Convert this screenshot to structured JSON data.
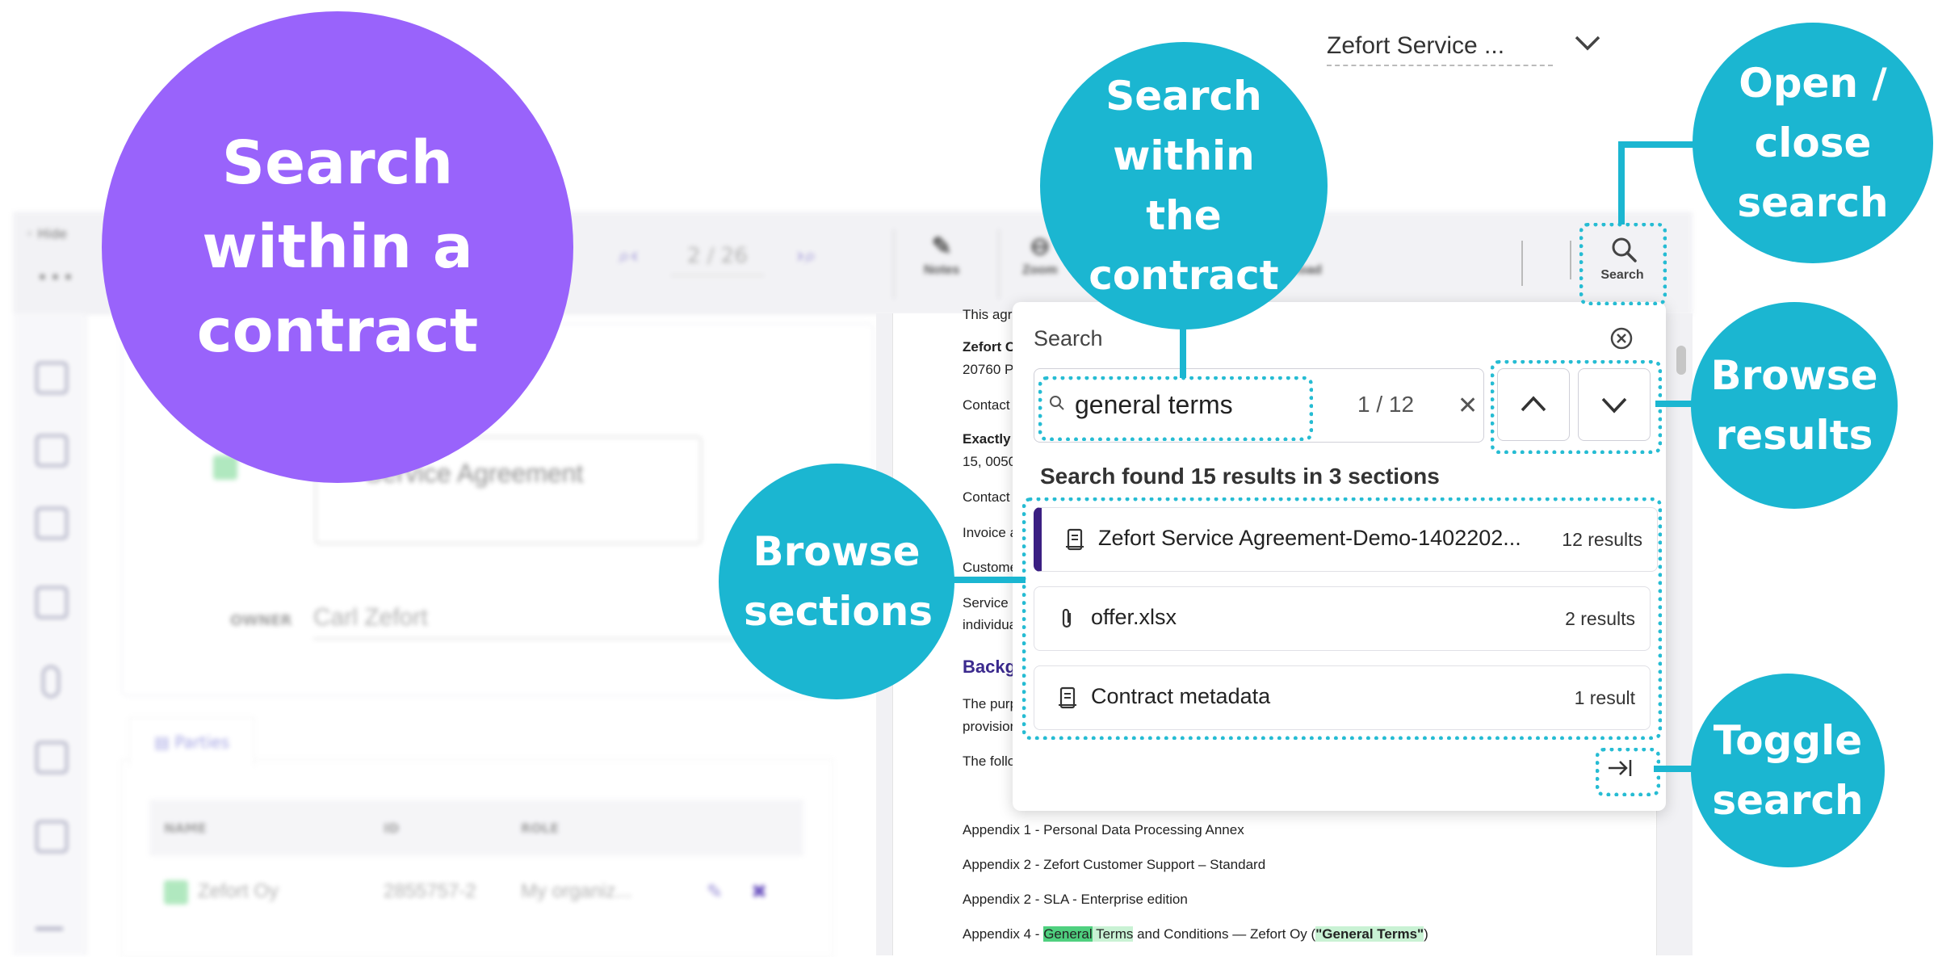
{
  "callouts": {
    "main": "Search within a contract",
    "search_within": "Search within the contract",
    "open_close": "Open / close search",
    "browse_results": "Browse results",
    "browse_sections": "Browse sections",
    "toggle_search": "Toggle search"
  },
  "toolbar": {
    "hide_label": "Hide",
    "page_indicator": "2 / 26",
    "notes_label": "Notes",
    "zoom_label": "Zoom",
    "download_label": "load",
    "document_select": "Zefort Service ...",
    "search_label": "Search"
  },
  "left_panel": {
    "title_value": "Service Agreement",
    "owner_label": "OWNER",
    "owner_value": "Carl Zefort",
    "parties_tab": "Parties",
    "parties_columns": [
      "NAME",
      "ID",
      "ROLE"
    ],
    "parties_rows": [
      {
        "name": "Zefort Oy",
        "id": "2855757-2",
        "role": "My organiz..."
      }
    ]
  },
  "document": {
    "lines": [
      {
        "text": "This agr"
      },
      {
        "text": "Zefort C",
        "bold": true
      },
      {
        "text": "20760 P"
      },
      {
        "text": "Contact"
      },
      {
        "text": "Exactly",
        "bold": true
      },
      {
        "text": "15, 0050"
      },
      {
        "text": "Contact"
      },
      {
        "text": "Invoice a"
      },
      {
        "text": "Custome"
      },
      {
        "text": "Service I"
      },
      {
        "text": "individua"
      }
    ],
    "heading": "Backg",
    "lines2": [
      {
        "text": "The purp"
      },
      {
        "text": "provision"
      },
      {
        "text": "The follo"
      }
    ],
    "appendices": [
      "Appendix 1 - Personal Data Processing Annex",
      "Appendix 2 - Zefort Customer Support – Standard",
      "Appendix 2 - SLA - Enterprise edition"
    ],
    "appendix4_prefix": "Appendix 4 - ",
    "appendix4_hl1": "General",
    "appendix4_hl2": " Terms",
    "appendix4_mid": " and Conditions — Zefort Oy (",
    "appendix4_quote": "\"General Terms\"",
    "appendix4_end": ")"
  },
  "search": {
    "title": "Search",
    "query": "general terms",
    "position": "1 / 12",
    "summary": "Search found 15 results in 3 sections",
    "sections": [
      {
        "name": "Zefort Service Agreement-Demo-1402202...",
        "count": "12 results",
        "icon": "contract-icon",
        "active": true
      },
      {
        "name": "offer.xlsx",
        "count": "2 results",
        "icon": "paperclip-icon",
        "active": false
      },
      {
        "name": "Contract metadata",
        "count": "1 result",
        "icon": "contract-icon",
        "active": false
      }
    ]
  },
  "colors": {
    "teal": "#1bb6d1",
    "purple": "#9963fb",
    "active_section": "#3b1f82",
    "highlight_strong": "#4fd07f",
    "highlight_light": "#c9f2d4"
  }
}
